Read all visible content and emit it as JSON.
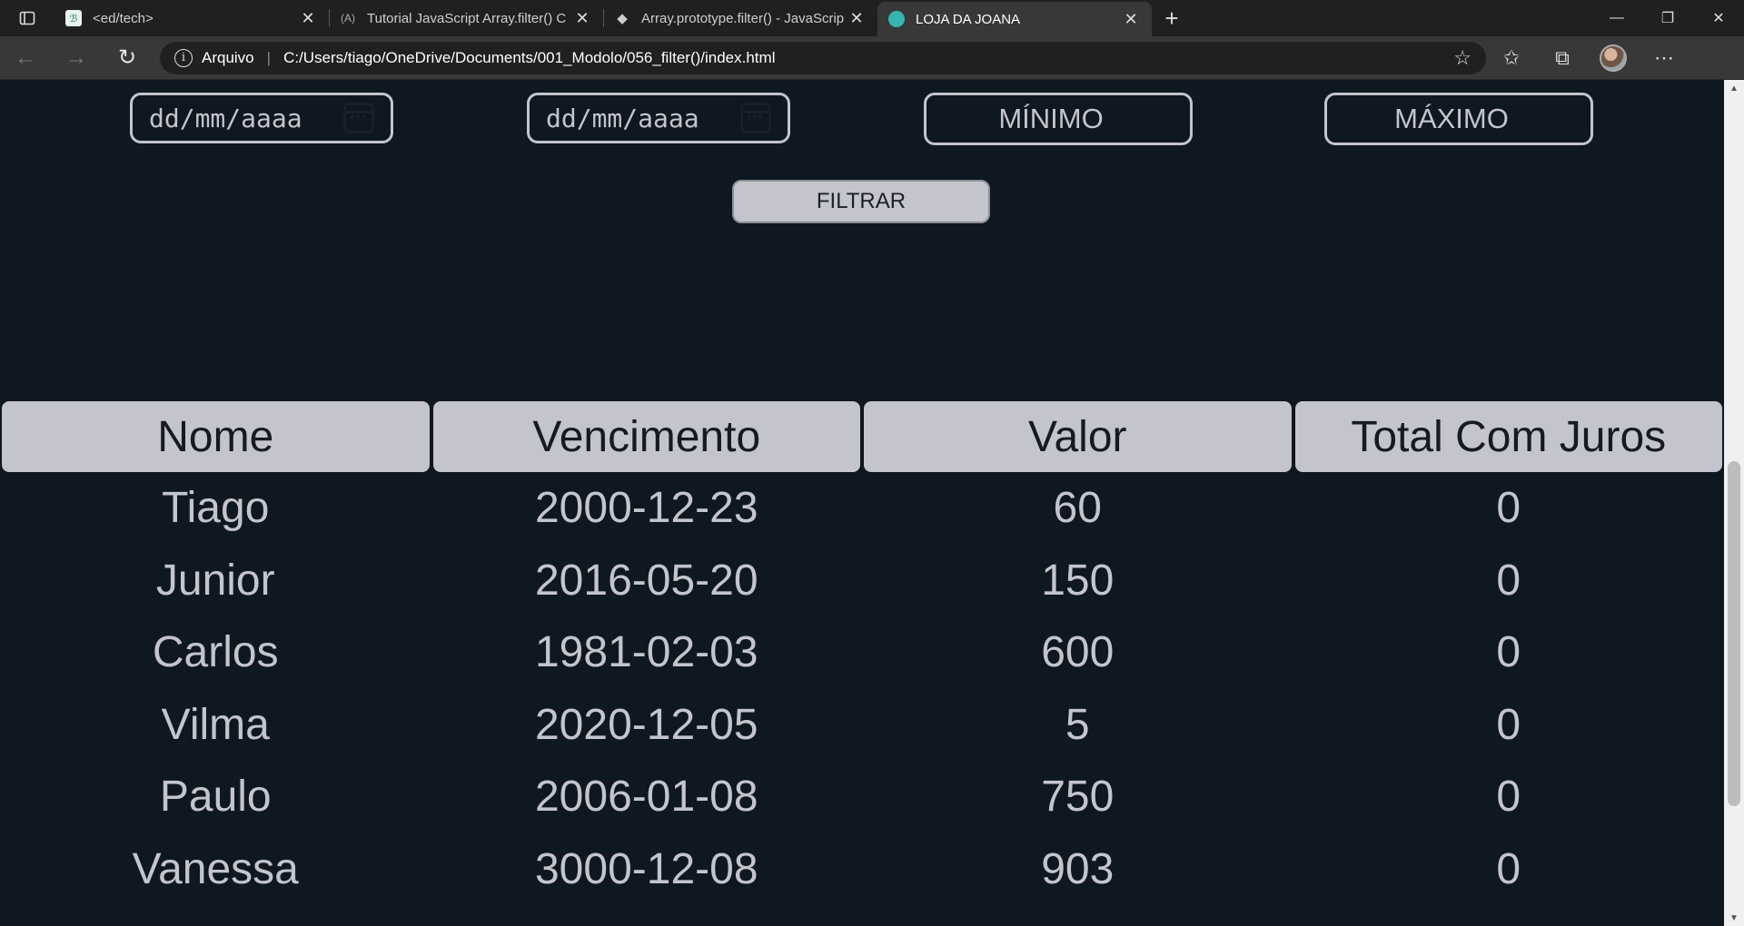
{
  "browser": {
    "tabs": [
      {
        "title": "<ed/tech>",
        "favicon": "edtech-logo-icon",
        "active": false
      },
      {
        "title": "Tutorial JavaScript Array.filter() C",
        "favicon": "code-brackets-icon",
        "active": false
      },
      {
        "title": "Array.prototype.filter() - JavaScrip",
        "favicon": "mdn-dino-icon",
        "active": false
      },
      {
        "title": "LOJA DA JOANA",
        "favicon": "globe-favicon-icon",
        "active": true
      }
    ],
    "address": {
      "protocol_label": "Arquivo",
      "url": "C:/Users/tiago/OneDrive/Documents/001_Modolo/056_filter()/index.html"
    }
  },
  "filters": {
    "date_start_placeholder": "dd/mm/aaaa",
    "date_end_placeholder": "dd/mm/aaaa",
    "min_placeholder": "MÍNIMO",
    "max_placeholder": "MÁXIMO",
    "button_label": "FILTRAR"
  },
  "table": {
    "headers": [
      "Nome",
      "Vencimento",
      "Valor",
      "Total Com Juros"
    ],
    "rows": [
      [
        "Tiago",
        "2000-12-23",
        "60",
        "0"
      ],
      [
        "Junior",
        "2016-05-20",
        "150",
        "0"
      ],
      [
        "Carlos",
        "1981-02-03",
        "600",
        "0"
      ],
      [
        "Vilma",
        "2020-12-05",
        "5",
        "0"
      ],
      [
        "Paulo",
        "2006-01-08",
        "750",
        "0"
      ],
      [
        "Vanessa",
        "3000-12-08",
        "903",
        "0"
      ]
    ]
  },
  "colors": {
    "page_bg": "#0f1721",
    "accent_gray": "#c4c4cc",
    "dark_text": "#161a22"
  }
}
